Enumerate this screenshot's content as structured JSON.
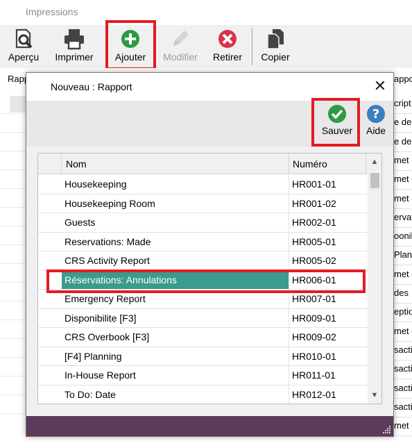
{
  "parent": {
    "title": "Impressions",
    "toolbar": {
      "apercu": "Aperçu",
      "imprimer": "Imprimer",
      "ajouter": "Ajouter",
      "modifier": "Modifier",
      "retirer": "Retirer",
      "copier": "Copier"
    },
    "left_header": "Rapp",
    "right_header": "apport",
    "right_rows": [
      "cript",
      "e des",
      "e des",
      "met d",
      "met d",
      "met d",
      "ervat",
      "oonib",
      "Plan",
      "met d",
      "des",
      "eptio",
      "met d",
      "sacti",
      "sacti",
      "sacti",
      "sacti",
      "met d"
    ]
  },
  "dialog": {
    "title": "Nouveau : Rapport",
    "close": "✕",
    "save_label": "Sauver",
    "help_label": "Aide",
    "grid": {
      "columns": {
        "nom": "Nom",
        "numero": "Numéro"
      },
      "rows": [
        {
          "nom": "Housekeeping",
          "numero": "HR001-01"
        },
        {
          "nom": "Housekeeping Room",
          "numero": "HR001-02"
        },
        {
          "nom": "Guests",
          "numero": "HR002-01"
        },
        {
          "nom": "Reservations: Made",
          "numero": "HR005-01"
        },
        {
          "nom": "CRS Activity Report",
          "numero": "HR005-02"
        },
        {
          "nom": "Réservations: Annulations",
          "numero": "HR006-01"
        },
        {
          "nom": "Emergency Report",
          "numero": "HR007-01"
        },
        {
          "nom": "Disponibilite [F3]",
          "numero": "HR009-01"
        },
        {
          "nom": "CRS Overbook [F3]",
          "numero": "HR009-02"
        },
        {
          "nom": "[F4] Planning",
          "numero": "HR010-01"
        },
        {
          "nom": "In-House Report",
          "numero": "HR011-01"
        },
        {
          "nom": "To Do: Date",
          "numero": "HR012-01"
        }
      ]
    }
  },
  "colors": {
    "highlight": "#e41b23",
    "selection": "#3a9c8c",
    "statusbar": "#5b3a5a",
    "add_green": "#2e9a44",
    "remove_red": "#d9344a",
    "help_blue": "#3b7fbf"
  }
}
